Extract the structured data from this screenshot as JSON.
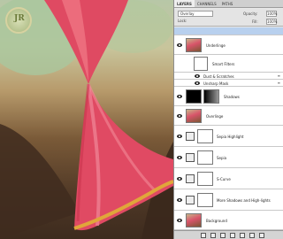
{
  "panel": {
    "tabs": [
      "LAYERS",
      "CHANNELS",
      "PATHS"
    ],
    "active_tab": "LAYERS",
    "blend_mode": "Overlay",
    "opacity_label": "Opacity:",
    "opacity_value": "100%",
    "lock_label": "Lock:",
    "fill_label": "Fill:",
    "fill_value": "100%"
  },
  "layers": [
    {
      "name": "",
      "kind": "top-selected"
    },
    {
      "name": "Underlinge",
      "kind": "paint"
    },
    {
      "name": "Smart Filters",
      "kind": "smartfilters"
    },
    {
      "name": "Dust & Scratches",
      "kind": "filter"
    },
    {
      "name": "Unsharp Mask",
      "kind": "filter"
    },
    {
      "name": "Shadows",
      "kind": "shadow"
    },
    {
      "name": "Overlinge",
      "kind": "paint"
    },
    {
      "name": "Sepia Highlight",
      "kind": "adjust"
    },
    {
      "name": "Sepia",
      "kind": "adjust"
    },
    {
      "name": "S-Curve",
      "kind": "adjust"
    },
    {
      "name": "More Shadows and High-lights",
      "kind": "adjust"
    },
    {
      "name": "Background",
      "kind": "paint"
    }
  ],
  "colors": {
    "selection": "#b8d0ee",
    "panel_bg": "#e8e8e8",
    "ribbon_red": "#e0465d",
    "ribbon_gold": "#d8a336"
  }
}
